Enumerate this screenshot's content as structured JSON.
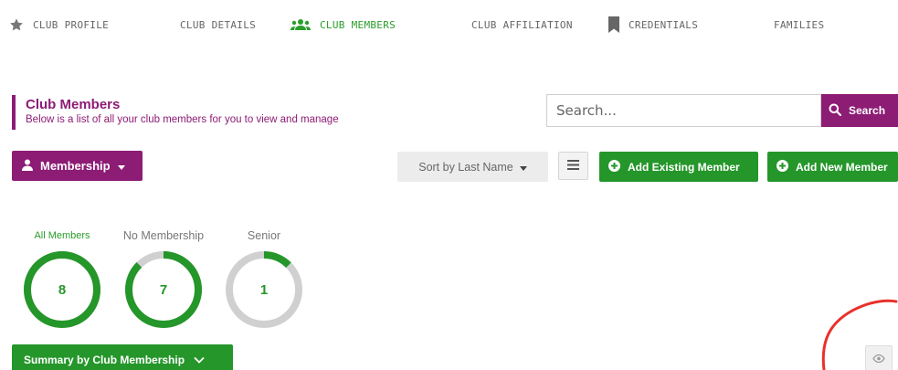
{
  "nav": {
    "items": [
      {
        "label": "CLUB PROFILE",
        "icon": "star-icon"
      },
      {
        "label": "CLUB DETAILS",
        "icon": ""
      },
      {
        "label": "CLUB MEMBERS",
        "icon": "users-icon",
        "active": true
      },
      {
        "label": "CLUB AFFILIATION",
        "icon": ""
      },
      {
        "label": "CREDENTIALS",
        "icon": "bookmark-icon"
      },
      {
        "label": "FAMILIES",
        "icon": ""
      }
    ]
  },
  "page": {
    "title": "Club Members",
    "subtitle": "Below is a list of all your club members for you to view and manage"
  },
  "search": {
    "placeholder": "Search...",
    "button_label": "Search"
  },
  "toolbar": {
    "membership_label": "Membership",
    "sort_label": "Sort by Last Name",
    "add_existing_label": "Add Existing Member",
    "add_new_label": "Add New Member"
  },
  "stats": [
    {
      "label": "All Members",
      "value": "8",
      "fraction": 1.0
    },
    {
      "label": "No Membership",
      "value": "7",
      "fraction": 0.875
    },
    {
      "label": "Senior",
      "value": "1",
      "fraction": 0.125
    }
  ],
  "summary": {
    "label": "Summary by Club Membership"
  },
  "colors": {
    "brand_purple": "#8d1c75",
    "accent_green": "#25962a",
    "ring_track": "#d0d0d0",
    "annotation_red": "#e8322b"
  }
}
